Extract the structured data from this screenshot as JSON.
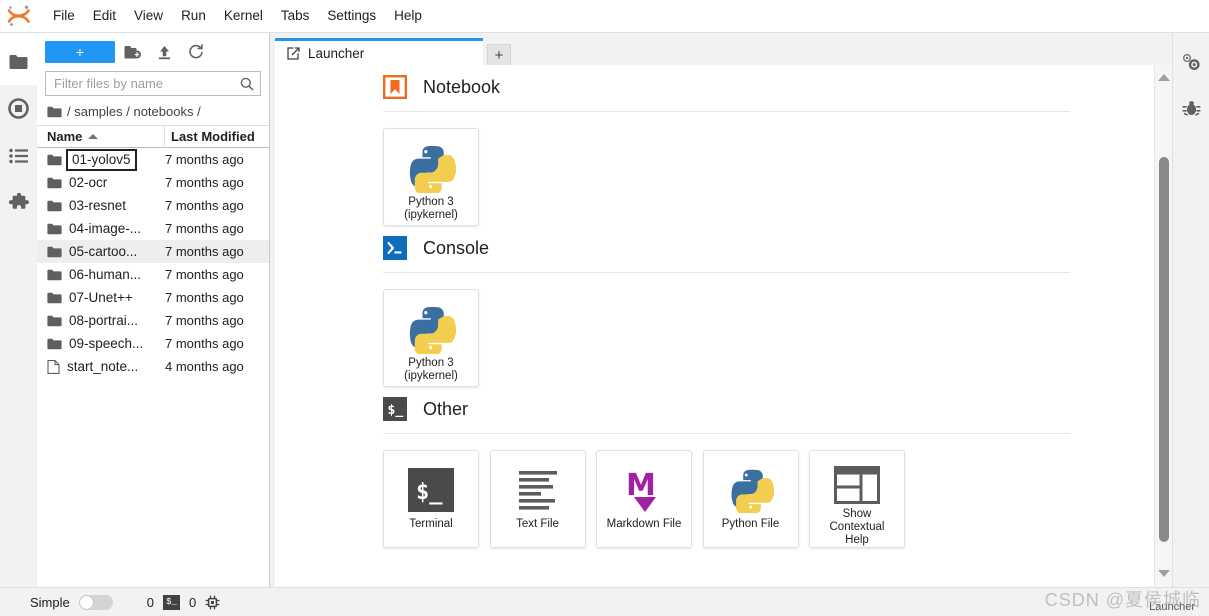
{
  "app": {
    "logo_name": "jupyter-logo",
    "accent_blue": "#2196f3",
    "orange": "#ee6c21",
    "menu": [
      {
        "label": "File"
      },
      {
        "label": "Edit"
      },
      {
        "label": "View"
      },
      {
        "label": "Run"
      },
      {
        "label": "Kernel"
      },
      {
        "label": "Tabs"
      },
      {
        "label": "Settings"
      },
      {
        "label": "Help"
      }
    ]
  },
  "left_activitybar": {
    "items": [
      {
        "name": "file-browser-icon",
        "label": "File Browser",
        "active": true
      },
      {
        "name": "running-terminals-icon",
        "label": "Running Terminals and Kernels",
        "active": false
      },
      {
        "name": "commands-list-icon",
        "label": "Commands",
        "active": false
      },
      {
        "name": "extension-puzzle-icon",
        "label": "Extension Manager",
        "active": false
      }
    ]
  },
  "right_activitybar": {
    "items": [
      {
        "name": "property-inspector-icon",
        "label": "Property Inspector"
      },
      {
        "name": "debugger-bug-icon",
        "label": "Debugger"
      }
    ]
  },
  "filebrowser": {
    "toolbar": {
      "new_label": "+",
      "new_folder_icon": "new-folder-icon",
      "upload_icon": "upload-icon",
      "refresh_icon": "refresh-icon"
    },
    "filter": {
      "placeholder": "Filter files by name",
      "value": "",
      "search_icon": "search-icon"
    },
    "breadcrumb": {
      "root_icon": "folder-icon",
      "text": "/ samples / notebooks /"
    },
    "columns": {
      "name": "Name",
      "last_modified": "Last Modified",
      "sort_icon": "sort-ascending-icon"
    },
    "rows": [
      {
        "name": "01-yolov5",
        "modified": "7 months ago",
        "type": "folder",
        "editing": true,
        "selected": false
      },
      {
        "name": "02-ocr",
        "modified": "7 months ago",
        "type": "folder",
        "editing": false,
        "selected": false
      },
      {
        "name": "03-resnet",
        "modified": "7 months ago",
        "type": "folder",
        "editing": false,
        "selected": false
      },
      {
        "name": "04-image-...",
        "modified": "7 months ago",
        "type": "folder",
        "editing": false,
        "selected": false
      },
      {
        "name": "05-cartoo...",
        "modified": "7 months ago",
        "type": "folder",
        "editing": false,
        "selected": true
      },
      {
        "name": "06-human...",
        "modified": "7 months ago",
        "type": "folder",
        "editing": false,
        "selected": false
      },
      {
        "name": "07-Unet++",
        "modified": "7 months ago",
        "type": "folder",
        "editing": false,
        "selected": false
      },
      {
        "name": "08-portrai...",
        "modified": "7 months ago",
        "type": "folder",
        "editing": false,
        "selected": false
      },
      {
        "name": "09-speech...",
        "modified": "7 months ago",
        "type": "folder",
        "editing": false,
        "selected": false
      },
      {
        "name": "start_note...",
        "modified": "4 months ago",
        "type": "file",
        "editing": false,
        "selected": false
      }
    ]
  },
  "maintabs": {
    "tabs": [
      {
        "label": "Launcher",
        "icon": "launcher-icon",
        "active": true
      }
    ],
    "add_label": "+"
  },
  "launcher": {
    "sections": [
      {
        "title": "Notebook",
        "icon": "notebook-bookmark-icon",
        "cards": [
          {
            "label": "Python 3\n(ipykernel)",
            "line1": "Python 3",
            "line2": "(ipykernel)",
            "icon": "python-logo-icon"
          }
        ]
      },
      {
        "title": "Console",
        "icon": "console-prompt-icon",
        "cards": [
          {
            "label": "Python 3\n(ipykernel)",
            "line1": "Python 3",
            "line2": "(ipykernel)",
            "icon": "python-logo-icon"
          }
        ]
      },
      {
        "title": "Other",
        "icon": "other-shell-icon",
        "cards": [
          {
            "line1": "Terminal",
            "line2": "",
            "line3": "",
            "icon": "terminal-icon"
          },
          {
            "line1": "Text File",
            "line2": "",
            "line3": "",
            "icon": "text-file-icon"
          },
          {
            "line1": "Markdown File",
            "line2": "",
            "line3": "",
            "icon": "markdown-icon"
          },
          {
            "line1": "Python File",
            "line2": "",
            "line3": "",
            "icon": "python-file-icon"
          },
          {
            "line1": "Show",
            "line2": "Contextual",
            "line3": "Help",
            "icon": "contextual-help-icon"
          }
        ]
      }
    ],
    "scrollbar": {
      "up_icon": "scroll-up-arrow",
      "down_icon": "scroll-down-arrow"
    }
  },
  "statusbar": {
    "mode_label": "Simple",
    "mode_on": false,
    "kernel_count": "0",
    "terminal_badge": "$_",
    "terminal_count": "0",
    "kernel_icon": "kernel-chip-icon",
    "right_label": "Launcher",
    "watermark": "CSDN @夏侯城临"
  }
}
